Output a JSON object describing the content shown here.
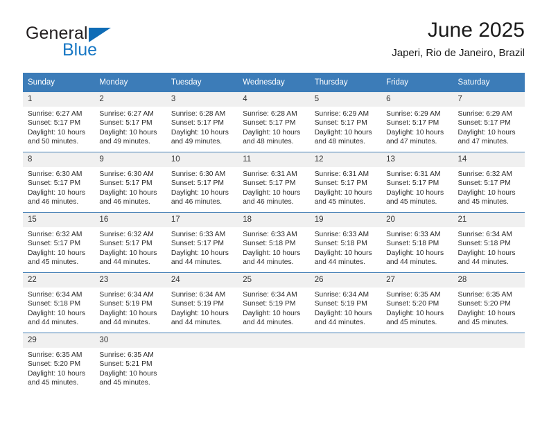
{
  "logo": {
    "primary_text": "General",
    "secondary_text": "Blue",
    "triangle_icon": "triangle-icon",
    "primary_color": "#231f20",
    "secondary_color": "#1777c4"
  },
  "header": {
    "title": "June 2025",
    "subtitle": "Japeri, Rio de Janeiro, Brazil"
  },
  "theme": {
    "header_row_background": "#3c7cb8",
    "header_row_text": "#ffffff",
    "row_separator": "#3f7cb4",
    "daynum_background": "#f0f0f0"
  },
  "calendar": {
    "weekday_headers": [
      "Sunday",
      "Monday",
      "Tuesday",
      "Wednesday",
      "Thursday",
      "Friday",
      "Saturday"
    ],
    "labels": {
      "sunrise_prefix": "Sunrise:",
      "sunset_prefix": "Sunset:",
      "daylight_prefix": "Daylight:"
    },
    "weeks": [
      [
        {
          "day": "1",
          "sunrise": "Sunrise: 6:27 AM",
          "sunset": "Sunset: 5:17 PM",
          "daylight_line1": "Daylight: 10 hours",
          "daylight_line2": "and 50 minutes."
        },
        {
          "day": "2",
          "sunrise": "Sunrise: 6:27 AM",
          "sunset": "Sunset: 5:17 PM",
          "daylight_line1": "Daylight: 10 hours",
          "daylight_line2": "and 49 minutes."
        },
        {
          "day": "3",
          "sunrise": "Sunrise: 6:28 AM",
          "sunset": "Sunset: 5:17 PM",
          "daylight_line1": "Daylight: 10 hours",
          "daylight_line2": "and 49 minutes."
        },
        {
          "day": "4",
          "sunrise": "Sunrise: 6:28 AM",
          "sunset": "Sunset: 5:17 PM",
          "daylight_line1": "Daylight: 10 hours",
          "daylight_line2": "and 48 minutes."
        },
        {
          "day": "5",
          "sunrise": "Sunrise: 6:29 AM",
          "sunset": "Sunset: 5:17 PM",
          "daylight_line1": "Daylight: 10 hours",
          "daylight_line2": "and 48 minutes."
        },
        {
          "day": "6",
          "sunrise": "Sunrise: 6:29 AM",
          "sunset": "Sunset: 5:17 PM",
          "daylight_line1": "Daylight: 10 hours",
          "daylight_line2": "and 47 minutes."
        },
        {
          "day": "7",
          "sunrise": "Sunrise: 6:29 AM",
          "sunset": "Sunset: 5:17 PM",
          "daylight_line1": "Daylight: 10 hours",
          "daylight_line2": "and 47 minutes."
        }
      ],
      [
        {
          "day": "8",
          "sunrise": "Sunrise: 6:30 AM",
          "sunset": "Sunset: 5:17 PM",
          "daylight_line1": "Daylight: 10 hours",
          "daylight_line2": "and 46 minutes."
        },
        {
          "day": "9",
          "sunrise": "Sunrise: 6:30 AM",
          "sunset": "Sunset: 5:17 PM",
          "daylight_line1": "Daylight: 10 hours",
          "daylight_line2": "and 46 minutes."
        },
        {
          "day": "10",
          "sunrise": "Sunrise: 6:30 AM",
          "sunset": "Sunset: 5:17 PM",
          "daylight_line1": "Daylight: 10 hours",
          "daylight_line2": "and 46 minutes."
        },
        {
          "day": "11",
          "sunrise": "Sunrise: 6:31 AM",
          "sunset": "Sunset: 5:17 PM",
          "daylight_line1": "Daylight: 10 hours",
          "daylight_line2": "and 46 minutes."
        },
        {
          "day": "12",
          "sunrise": "Sunrise: 6:31 AM",
          "sunset": "Sunset: 5:17 PM",
          "daylight_line1": "Daylight: 10 hours",
          "daylight_line2": "and 45 minutes."
        },
        {
          "day": "13",
          "sunrise": "Sunrise: 6:31 AM",
          "sunset": "Sunset: 5:17 PM",
          "daylight_line1": "Daylight: 10 hours",
          "daylight_line2": "and 45 minutes."
        },
        {
          "day": "14",
          "sunrise": "Sunrise: 6:32 AM",
          "sunset": "Sunset: 5:17 PM",
          "daylight_line1": "Daylight: 10 hours",
          "daylight_line2": "and 45 minutes."
        }
      ],
      [
        {
          "day": "15",
          "sunrise": "Sunrise: 6:32 AM",
          "sunset": "Sunset: 5:17 PM",
          "daylight_line1": "Daylight: 10 hours",
          "daylight_line2": "and 45 minutes."
        },
        {
          "day": "16",
          "sunrise": "Sunrise: 6:32 AM",
          "sunset": "Sunset: 5:17 PM",
          "daylight_line1": "Daylight: 10 hours",
          "daylight_line2": "and 44 minutes."
        },
        {
          "day": "17",
          "sunrise": "Sunrise: 6:33 AM",
          "sunset": "Sunset: 5:17 PM",
          "daylight_line1": "Daylight: 10 hours",
          "daylight_line2": "and 44 minutes."
        },
        {
          "day": "18",
          "sunrise": "Sunrise: 6:33 AM",
          "sunset": "Sunset: 5:18 PM",
          "daylight_line1": "Daylight: 10 hours",
          "daylight_line2": "and 44 minutes."
        },
        {
          "day": "19",
          "sunrise": "Sunrise: 6:33 AM",
          "sunset": "Sunset: 5:18 PM",
          "daylight_line1": "Daylight: 10 hours",
          "daylight_line2": "and 44 minutes."
        },
        {
          "day": "20",
          "sunrise": "Sunrise: 6:33 AM",
          "sunset": "Sunset: 5:18 PM",
          "daylight_line1": "Daylight: 10 hours",
          "daylight_line2": "and 44 minutes."
        },
        {
          "day": "21",
          "sunrise": "Sunrise: 6:34 AM",
          "sunset": "Sunset: 5:18 PM",
          "daylight_line1": "Daylight: 10 hours",
          "daylight_line2": "and 44 minutes."
        }
      ],
      [
        {
          "day": "22",
          "sunrise": "Sunrise: 6:34 AM",
          "sunset": "Sunset: 5:18 PM",
          "daylight_line1": "Daylight: 10 hours",
          "daylight_line2": "and 44 minutes."
        },
        {
          "day": "23",
          "sunrise": "Sunrise: 6:34 AM",
          "sunset": "Sunset: 5:19 PM",
          "daylight_line1": "Daylight: 10 hours",
          "daylight_line2": "and 44 minutes."
        },
        {
          "day": "24",
          "sunrise": "Sunrise: 6:34 AM",
          "sunset": "Sunset: 5:19 PM",
          "daylight_line1": "Daylight: 10 hours",
          "daylight_line2": "and 44 minutes."
        },
        {
          "day": "25",
          "sunrise": "Sunrise: 6:34 AM",
          "sunset": "Sunset: 5:19 PM",
          "daylight_line1": "Daylight: 10 hours",
          "daylight_line2": "and 44 minutes."
        },
        {
          "day": "26",
          "sunrise": "Sunrise: 6:34 AM",
          "sunset": "Sunset: 5:19 PM",
          "daylight_line1": "Daylight: 10 hours",
          "daylight_line2": "and 44 minutes."
        },
        {
          "day": "27",
          "sunrise": "Sunrise: 6:35 AM",
          "sunset": "Sunset: 5:20 PM",
          "daylight_line1": "Daylight: 10 hours",
          "daylight_line2": "and 45 minutes."
        },
        {
          "day": "28",
          "sunrise": "Sunrise: 6:35 AM",
          "sunset": "Sunset: 5:20 PM",
          "daylight_line1": "Daylight: 10 hours",
          "daylight_line2": "and 45 minutes."
        }
      ],
      [
        {
          "day": "29",
          "sunrise": "Sunrise: 6:35 AM",
          "sunset": "Sunset: 5:20 PM",
          "daylight_line1": "Daylight: 10 hours",
          "daylight_line2": "and 45 minutes."
        },
        {
          "day": "30",
          "sunrise": "Sunrise: 6:35 AM",
          "sunset": "Sunset: 5:21 PM",
          "daylight_line1": "Daylight: 10 hours",
          "daylight_line2": "and 45 minutes."
        },
        {
          "day": "",
          "sunrise": "",
          "sunset": "",
          "daylight_line1": "",
          "daylight_line2": ""
        },
        {
          "day": "",
          "sunrise": "",
          "sunset": "",
          "daylight_line1": "",
          "daylight_line2": ""
        },
        {
          "day": "",
          "sunrise": "",
          "sunset": "",
          "daylight_line1": "",
          "daylight_line2": ""
        },
        {
          "day": "",
          "sunrise": "",
          "sunset": "",
          "daylight_line1": "",
          "daylight_line2": ""
        },
        {
          "day": "",
          "sunrise": "",
          "sunset": "",
          "daylight_line1": "",
          "daylight_line2": ""
        }
      ]
    ]
  }
}
